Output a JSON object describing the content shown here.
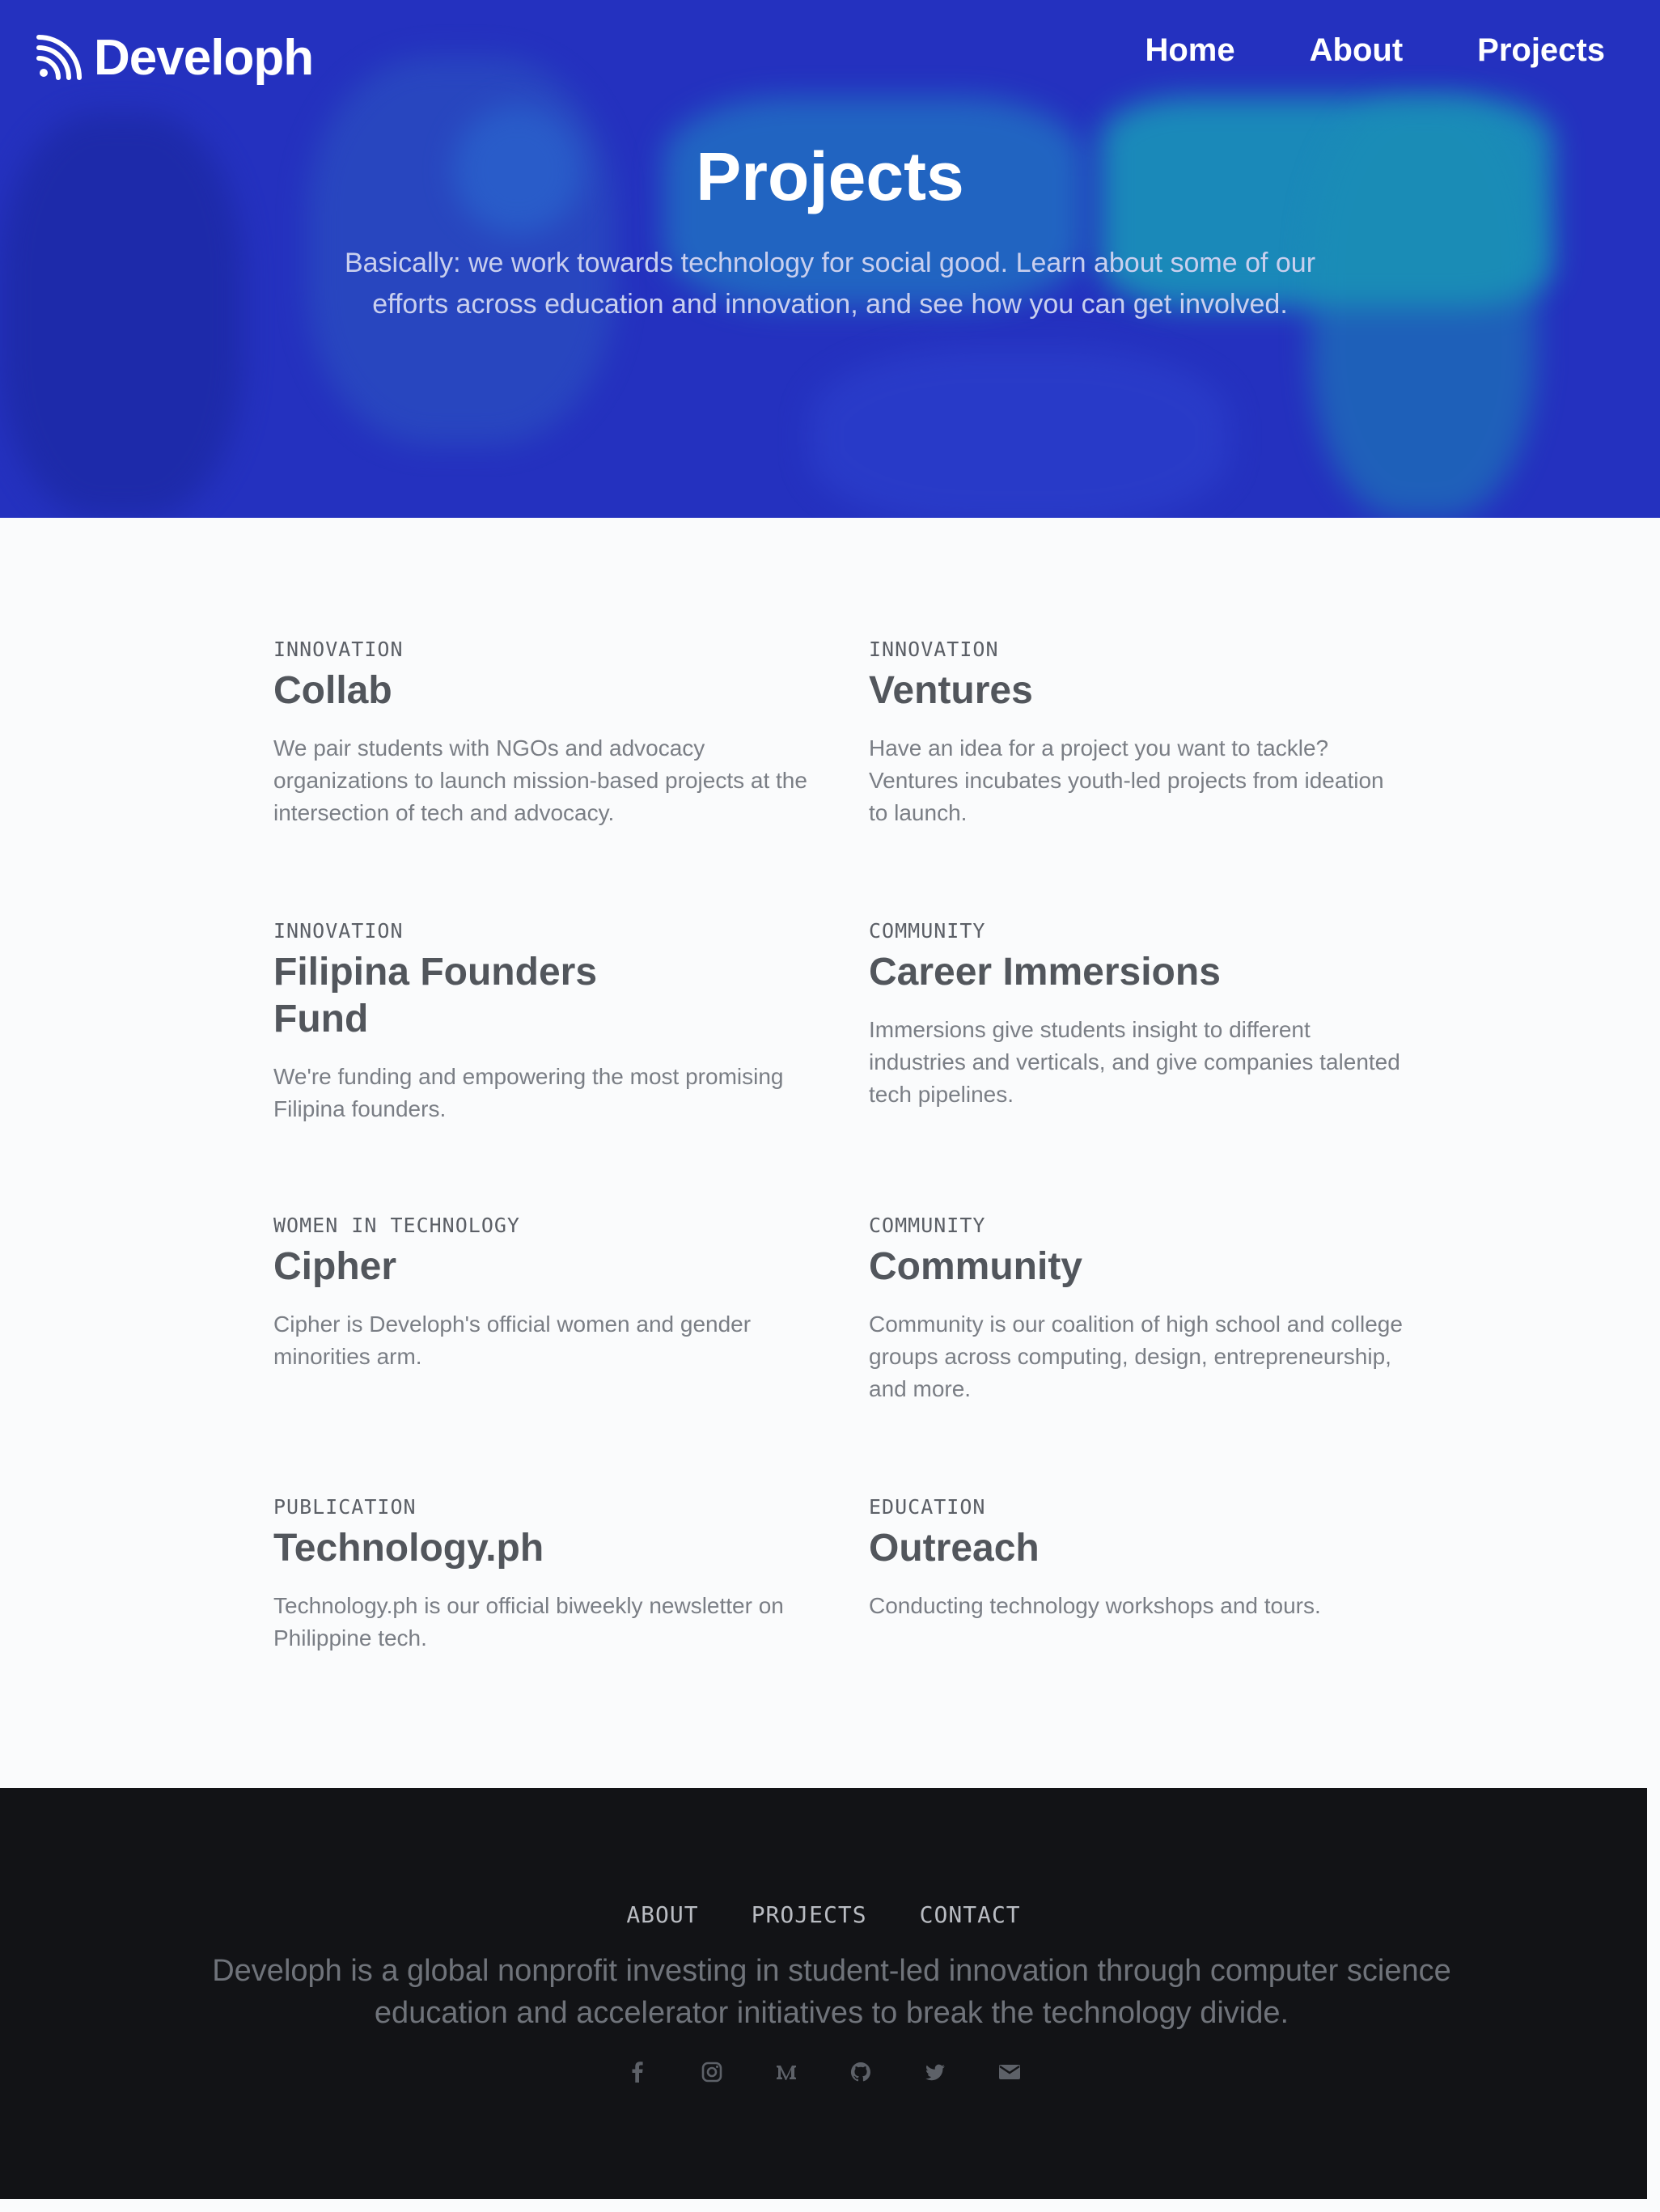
{
  "brand": {
    "name": "Developh"
  },
  "nav": {
    "items": [
      "Home",
      "About",
      "Projects"
    ]
  },
  "hero": {
    "title": "Projects",
    "subtitle": "Basically: we work towards technology for social good. Learn about some of our efforts across education and innovation, and see how you can get involved."
  },
  "projects": [
    {
      "category": "INNOVATION",
      "title": "Collab",
      "description": "We pair students with NGOs and advocacy organizations to launch mission-based projects at the intersection of tech and advocacy."
    },
    {
      "category": "INNOVATION",
      "title": "Ventures",
      "description": "Have an idea for a project you want to tackle? Ventures incubates youth-led projects from ideation to launch."
    },
    {
      "category": "INNOVATION",
      "title": "Filipina Founders Fund",
      "description": "We're funding and empowering the most promising Filipina founders."
    },
    {
      "category": "COMMUNITY",
      "title": "Career Immersions",
      "description": "Immersions give students insight to different industries and verticals, and give companies talented tech pipelines."
    },
    {
      "category": "WOMEN IN TECHNOLOGY",
      "title": "Cipher",
      "description": "Cipher is Developh's official women and gender minorities arm."
    },
    {
      "category": "COMMUNITY",
      "title": "Community",
      "description": "Community is our coalition of high school and college groups across computing, design, entrepreneurship, and more."
    },
    {
      "category": "PUBLICATION",
      "title": "Technology.ph",
      "description": "Technology.ph is our official biweekly newsletter on Philippine tech."
    },
    {
      "category": "EDUCATION",
      "title": "Outreach",
      "description": "Conducting technology workshops and tours."
    }
  ],
  "footer": {
    "nav": [
      "ABOUT",
      "PROJECTS",
      "CONTACT"
    ],
    "text": "Developh is a global nonprofit investing in student-led innovation through computer science education and accelerator initiatives to break the technology divide.",
    "socials": [
      "facebook-icon",
      "instagram-icon",
      "medium-icon",
      "github-icon",
      "twitter-icon",
      "email-icon"
    ]
  },
  "colors": {
    "hero_bg": "#2431bf",
    "footer_bg": "#121316",
    "page_bg": "#fafbfc"
  }
}
